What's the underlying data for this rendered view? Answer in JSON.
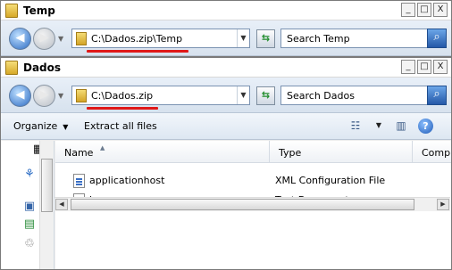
{
  "windows": [
    {
      "title": "Temp",
      "address": "C:\\Dados.zip\\Temp",
      "search_placeholder": "Search Temp"
    },
    {
      "title": "Dados",
      "address": "C:\\Dados.zip",
      "search_placeholder": "Search Dados",
      "toolbar": {
        "organize_label": "Organize",
        "extract_label": "Extract all files"
      },
      "columns": [
        "Name",
        "Type",
        "Compr"
      ],
      "files": [
        {
          "name": "applicationhost",
          "type": "XML Configuration File",
          "icon": "xml-file-icon"
        },
        {
          "name": "logs",
          "type": "Text Document",
          "icon": "text-file-icon"
        }
      ]
    }
  ],
  "highlight_color": "#e01818",
  "caption_glyphs": {
    "minimize": "_",
    "maximize": "□",
    "close": "X"
  }
}
